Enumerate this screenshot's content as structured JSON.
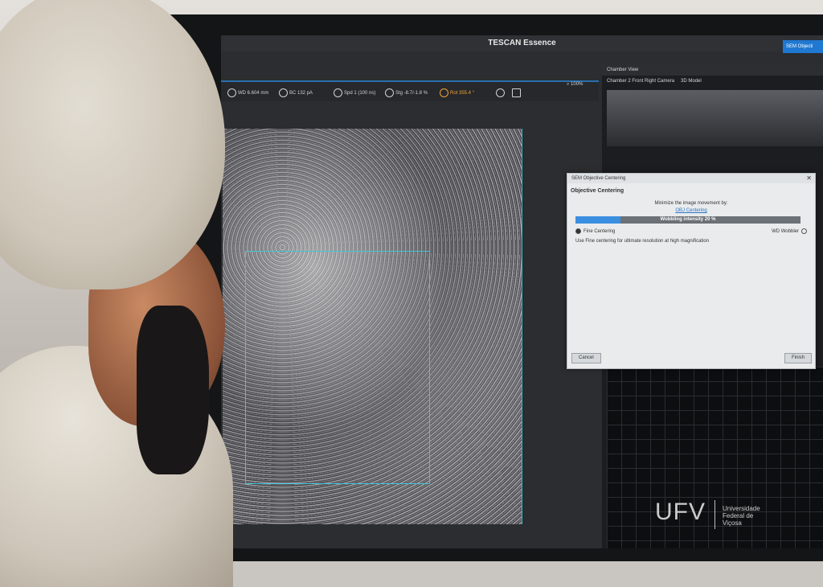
{
  "window": {
    "title": "TESCAN Essence",
    "corner_button": "SEM Objecti"
  },
  "toolbar": {
    "wd": "WD 6.604 mm",
    "bc": "BC 132 pA",
    "spd": "Spd 1 (100 ns)",
    "stg": "Stg -8.7/-1.8 %",
    "rot": "Rot 355.4 °",
    "zoom": "100%"
  },
  "chamber": {
    "header": "Chamber View",
    "tabs": [
      "Chamber 2 Front Right Camera",
      "3D Model"
    ]
  },
  "dialog": {
    "title": "SEM Objective Centering",
    "section": "Objective Centering",
    "message": "Minimize the image movement by:",
    "link": "OBJ Centering",
    "progress_label": "Wobbling intensity 20 %",
    "progress_value": 0.2,
    "option_left": "Fine Centering",
    "option_right": "WD Wobbler",
    "hint": "Use Fine centering for ultimate resolution at high magnification",
    "cancel": "Cancel",
    "finish": "Finish"
  },
  "watermark": {
    "logo": "UFV",
    "line1": "Universidade",
    "line2": "Federal de",
    "line3": "Viçosa"
  },
  "colors": {
    "accent": "#3b8fe0",
    "roi": "#46c3d6",
    "rotation": "#f0a43a"
  },
  "icons": [
    "wd-icon",
    "beam-current-icon",
    "scan-speed-icon",
    "stigmator-icon",
    "rotation-icon",
    "crosshair-icon",
    "camera-icon",
    "zoom-icon"
  ]
}
